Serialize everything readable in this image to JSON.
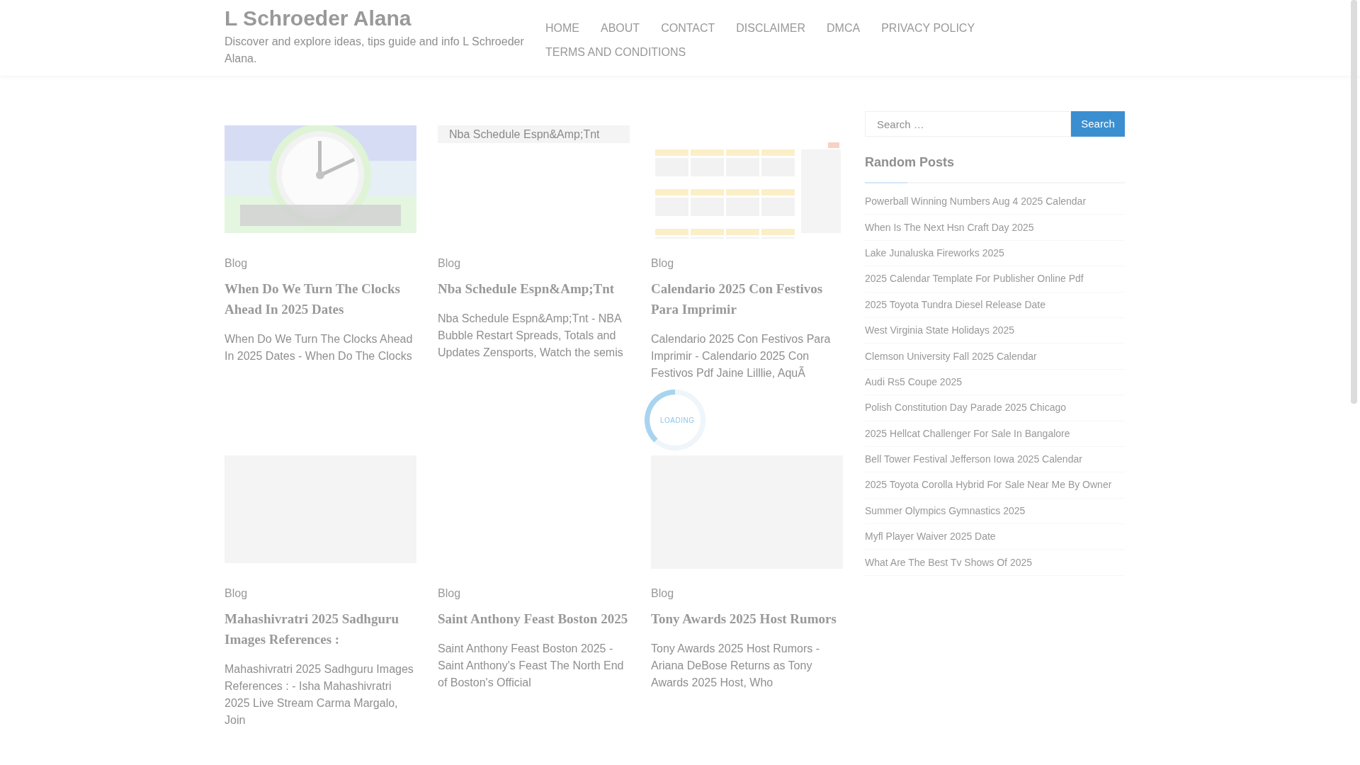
{
  "site": {
    "title": "L Schroeder Alana",
    "tagline": "Discover and explore ideas, tips guide and info L Schroeder Alana."
  },
  "nav": [
    {
      "label": "HOME"
    },
    {
      "label": "ABOUT"
    },
    {
      "label": "CONTACT"
    },
    {
      "label": "DISCLAIMER"
    },
    {
      "label": "DMCA"
    },
    {
      "label": "PRIVACY POLICY"
    },
    {
      "label": "TERMS AND CONDITIONS"
    }
  ],
  "posts": [
    {
      "image": {
        "kind": "clock"
      },
      "category": "Blog",
      "title": "When Do We Turn The Clocks Ahead In 2025 Dates",
      "excerpt": "When Do We Turn The Clocks Ahead In 2025 Dates - When Do The Clocks"
    },
    {
      "image": {
        "kind": "broken",
        "alt": "Nba Schedule Espn&Amp;Tnt"
      },
      "category": "Blog",
      "title": "Nba Schedule Espn&Amp;Tnt",
      "excerpt": "Nba Schedule Espn&Amp;Tnt - NBA Bubble Restart Spreads, Totals and Updates Zensports, Watch the semis"
    },
    {
      "image": {
        "kind": "calendar"
      },
      "category": "Blog",
      "title": "Calendario 2025 Con Festivos Para Imprimir",
      "excerpt": "Calendario 2025 Con Festivos Para Imprimir - Calendario 2025 Con Festivos Pdf Jaine Lilllie, AquÃ"
    },
    {
      "image": {
        "kind": "placeholder"
      },
      "category": "Blog",
      "title": "Mahashivratri 2025 Sadhguru Images References :",
      "excerpt": "Mahashivratri 2025 Sadhguru Images References : - Isha Mahashivratri 2025 Live Stream Carma Margalo, Join"
    },
    {
      "image": {
        "kind": "none"
      },
      "category": "Blog",
      "title": "Saint Anthony Feast Boston 2025",
      "excerpt": "Saint Anthony Feast Boston 2025 - Saint Anthony's Feast The North End of Boston's Official"
    },
    {
      "image": {
        "kind": "placeholder_tall"
      },
      "category": "Blog",
      "title": "Tony Awards 2025 Host Rumors",
      "excerpt": "Tony Awards 2025 Host Rumors - Ariana DeBose Returns as Tony Awards 2025 Host, Who"
    }
  ],
  "sidebar": {
    "search": {
      "placeholder": "Search …",
      "button": "Search"
    },
    "random_posts": {
      "heading": "Random Posts",
      "items": [
        "Powerball Winning Numbers Aug 4 2025 Calendar",
        "When Is The Next Hsn Craft Day 2025",
        "Lake Junaluska Fireworks 2025",
        "2025 Calendar Template For Publisher Online Pdf",
        "2025 Toyota Tundra Diesel Release Date",
        "West Virginia State Holidays 2025",
        "Clemson University Fall 2025 Calendar",
        "Audi Rs5 Coupe 2025",
        "Polish Constitution Day Parade 2025 Chicago",
        "2025 Hellcat Challenger For Sale In Bangalore",
        "Bell Tower Festival Jefferson Iowa 2025 Calendar",
        "2025 Toyota Corolla Hybrid For Sale Near Me By Owner",
        "Summer Olympics Gymnastics 2025",
        "Myfl Player Waiver 2025 Date",
        "What Are The Best Tv Shows Of 2025"
      ]
    }
  },
  "loader": {
    "text": "LOADING"
  }
}
